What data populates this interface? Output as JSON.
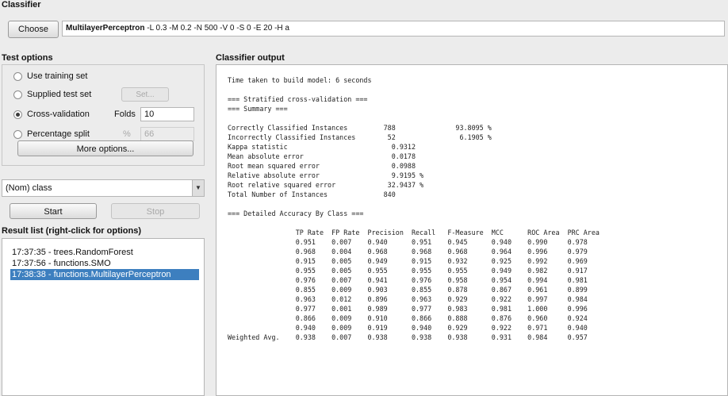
{
  "classifier": {
    "section_title": "Classifier",
    "choose_label": "Choose",
    "name": "MultilayerPerceptron",
    "options": " -L 0.3 -M 0.2 -N 500 -V 0 -S 0 -E 20 -H a"
  },
  "test_options": {
    "section_title": "Test options",
    "use_training_set": "Use training set",
    "supplied_test_set": "Supplied test set",
    "set_label": "Set...",
    "cross_validation": "Cross-validation",
    "folds_label": "Folds",
    "folds_value": "10",
    "percentage_split": "Percentage split",
    "percent_label": "%",
    "percent_value": "66",
    "selected": "cross_validation",
    "more_options_label": "More options..."
  },
  "class_select": {
    "value": "(Nom) class"
  },
  "run": {
    "start_label": "Start",
    "stop_label": "Stop"
  },
  "result_list": {
    "section_title": "Result list (right-click for options)",
    "items": [
      "17:37:35 - trees.RandomForest",
      "17:37:56 - functions.SMO",
      "17:38:38 - functions.MultilayerPerceptron"
    ],
    "selected_index": 2
  },
  "output": {
    "section_title": "Classifier output",
    "text": "Time taken to build model: 6 seconds\n\n=== Stratified cross-validation ===\n=== Summary ===\n\nCorrectly Classified Instances         788               93.8095 %\nIncorrectly Classified Instances        52                6.1905 %\nKappa statistic                          0.9312\nMean absolute error                      0.0178\nRoot mean squared error                  0.0988\nRelative absolute error                  9.9195 %\nRoot relative squared error             32.9437 %\nTotal Number of Instances              840\n\n=== Detailed Accuracy By Class ===\n\n                 TP Rate  FP Rate  Precision  Recall   F-Measure  MCC      ROC Area  PRC Area\n                 0.951    0.007    0.940      0.951    0.945      0.940    0.990     0.978\n                 0.968    0.004    0.968      0.968    0.968      0.964    0.996     0.979\n                 0.915    0.005    0.949      0.915    0.932      0.925    0.992     0.969\n                 0.955    0.005    0.955      0.955    0.955      0.949    0.982     0.917\n                 0.976    0.007    0.941      0.976    0.958      0.954    0.994     0.981\n                 0.855    0.009    0.903      0.855    0.878      0.867    0.961     0.899\n                 0.963    0.012    0.896      0.963    0.929      0.922    0.997     0.984\n                 0.977    0.001    0.989      0.977    0.983      0.981    1.000     0.996\n                 0.866    0.009    0.910      0.866    0.888      0.876    0.960     0.924\n                 0.940    0.009    0.919      0.940    0.929      0.922    0.971     0.940\nWeighted Avg.    0.938    0.007    0.938      0.938    0.938      0.931    0.984     0.957"
  }
}
